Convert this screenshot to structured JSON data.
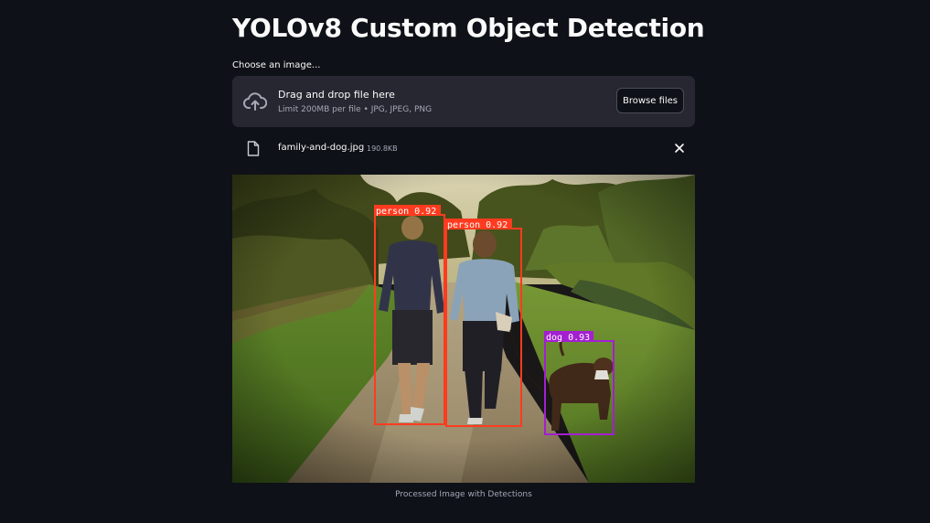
{
  "page": {
    "title": "YOLOv8 Custom Object Detection"
  },
  "uploader": {
    "label": "Choose an image...",
    "drop_text": "Drag and drop file here",
    "limit_text": "Limit 200MB per file • JPG, JPEG, PNG",
    "browse_label": "Browse files",
    "icon": "cloud-upload-icon"
  },
  "file": {
    "name": "family-and-dog.jpg",
    "size": "190.8KB",
    "icon": "file-icon",
    "remove_icon": "close-icon"
  },
  "result": {
    "detections": [
      {
        "label": "person 0.92",
        "color": "#ff3b1f"
      },
      {
        "label": "person 0.92",
        "color": "#ff3b1f"
      },
      {
        "label": "dog 0.93",
        "color": "#a31fd1"
      }
    ],
    "caption": "Processed Image with Detections"
  },
  "colors": {
    "background": "#0e1117",
    "panel": "#262730",
    "person_box": "#ff3b1f",
    "dog_box": "#a31fd1"
  }
}
